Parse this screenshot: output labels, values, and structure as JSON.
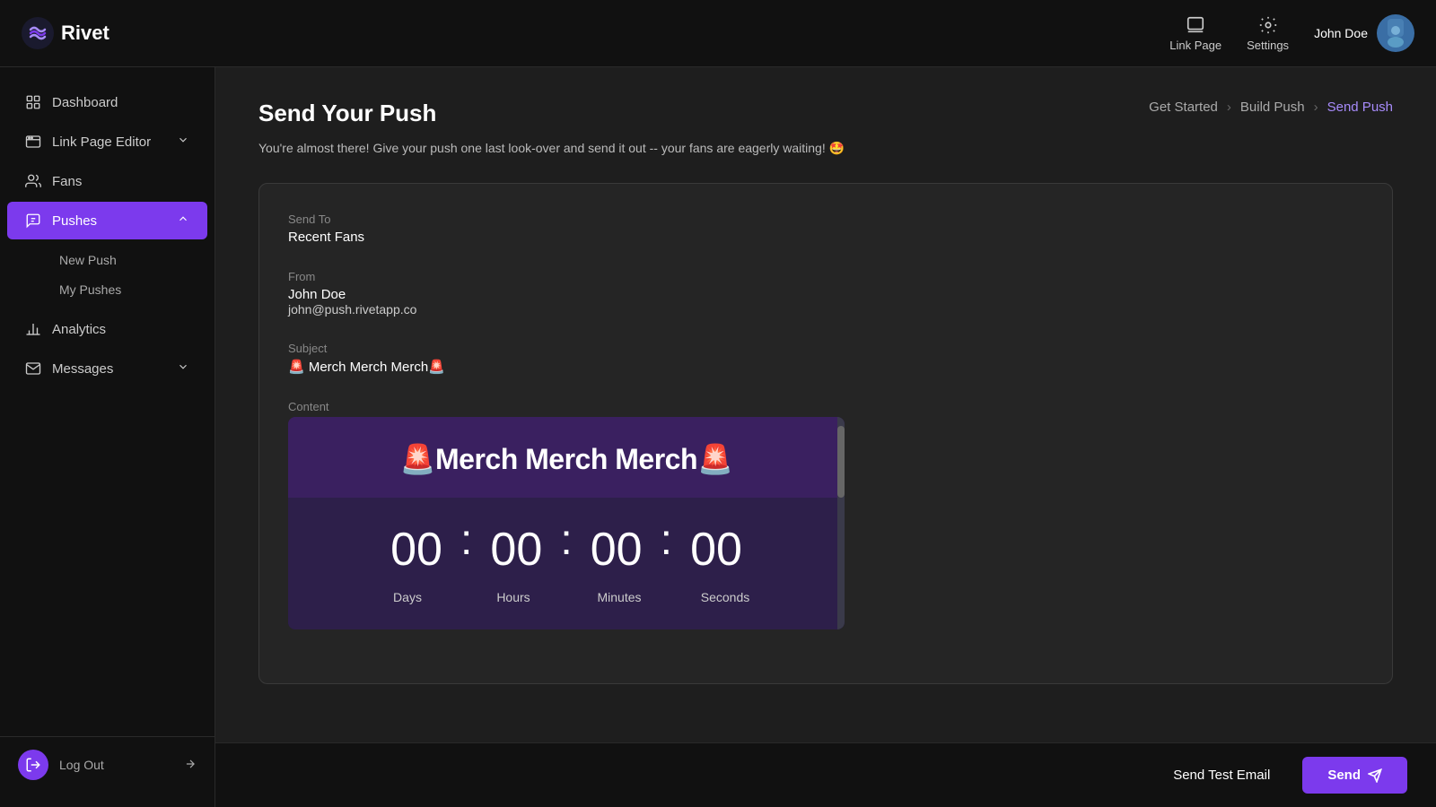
{
  "app": {
    "logo_text": "Rivet"
  },
  "topnav": {
    "link_page_label": "Link Page",
    "settings_label": "Settings",
    "user_name": "John Doe"
  },
  "sidebar": {
    "items": [
      {
        "id": "dashboard",
        "label": "Dashboard",
        "icon": "grid-icon",
        "active": false,
        "expandable": false
      },
      {
        "id": "link-page-editor",
        "label": "Link Page Editor",
        "icon": "browser-icon",
        "active": false,
        "expandable": true
      },
      {
        "id": "fans",
        "label": "Fans",
        "icon": "users-icon",
        "active": false,
        "expandable": false
      },
      {
        "id": "pushes",
        "label": "Pushes",
        "icon": "push-icon",
        "active": true,
        "expandable": true
      },
      {
        "id": "analytics",
        "label": "Analytics",
        "icon": "chart-icon",
        "active": false,
        "expandable": false
      },
      {
        "id": "messages",
        "label": "Messages",
        "icon": "message-icon",
        "active": false,
        "expandable": true
      }
    ],
    "pushes_sub": [
      {
        "id": "new-push",
        "label": "New Push"
      },
      {
        "id": "my-pushes",
        "label": "My Pushes"
      }
    ],
    "logout_label": "Log Out"
  },
  "page": {
    "title": "Send Your Push",
    "subtitle": "You're almost there! Give your push one last look-over and send it out -- your fans are eagerly waiting! 🤩",
    "breadcrumb": {
      "steps": [
        {
          "label": "Get Started",
          "active": false
        },
        {
          "label": "Build Push",
          "active": false
        },
        {
          "label": "Send Push",
          "active": true
        }
      ]
    }
  },
  "push_details": {
    "send_to_label": "Send To",
    "send_to_value": "Recent Fans",
    "from_label": "From",
    "from_name": "John Doe",
    "from_email": "john@push.rivetapp.co",
    "subject_label": "Subject",
    "subject_value": "🚨 Merch Merch Merch🚨",
    "content_label": "Content",
    "preview_title": "🚨Merch Merch Merch🚨",
    "countdown": {
      "days": "00",
      "hours": "00",
      "minutes": "00",
      "seconds": "00",
      "labels": [
        "Days",
        "Hours",
        "Minutes",
        "Seconds"
      ]
    }
  },
  "bottom_bar": {
    "send_test_label": "Send Test Email",
    "send_label": "Send"
  }
}
